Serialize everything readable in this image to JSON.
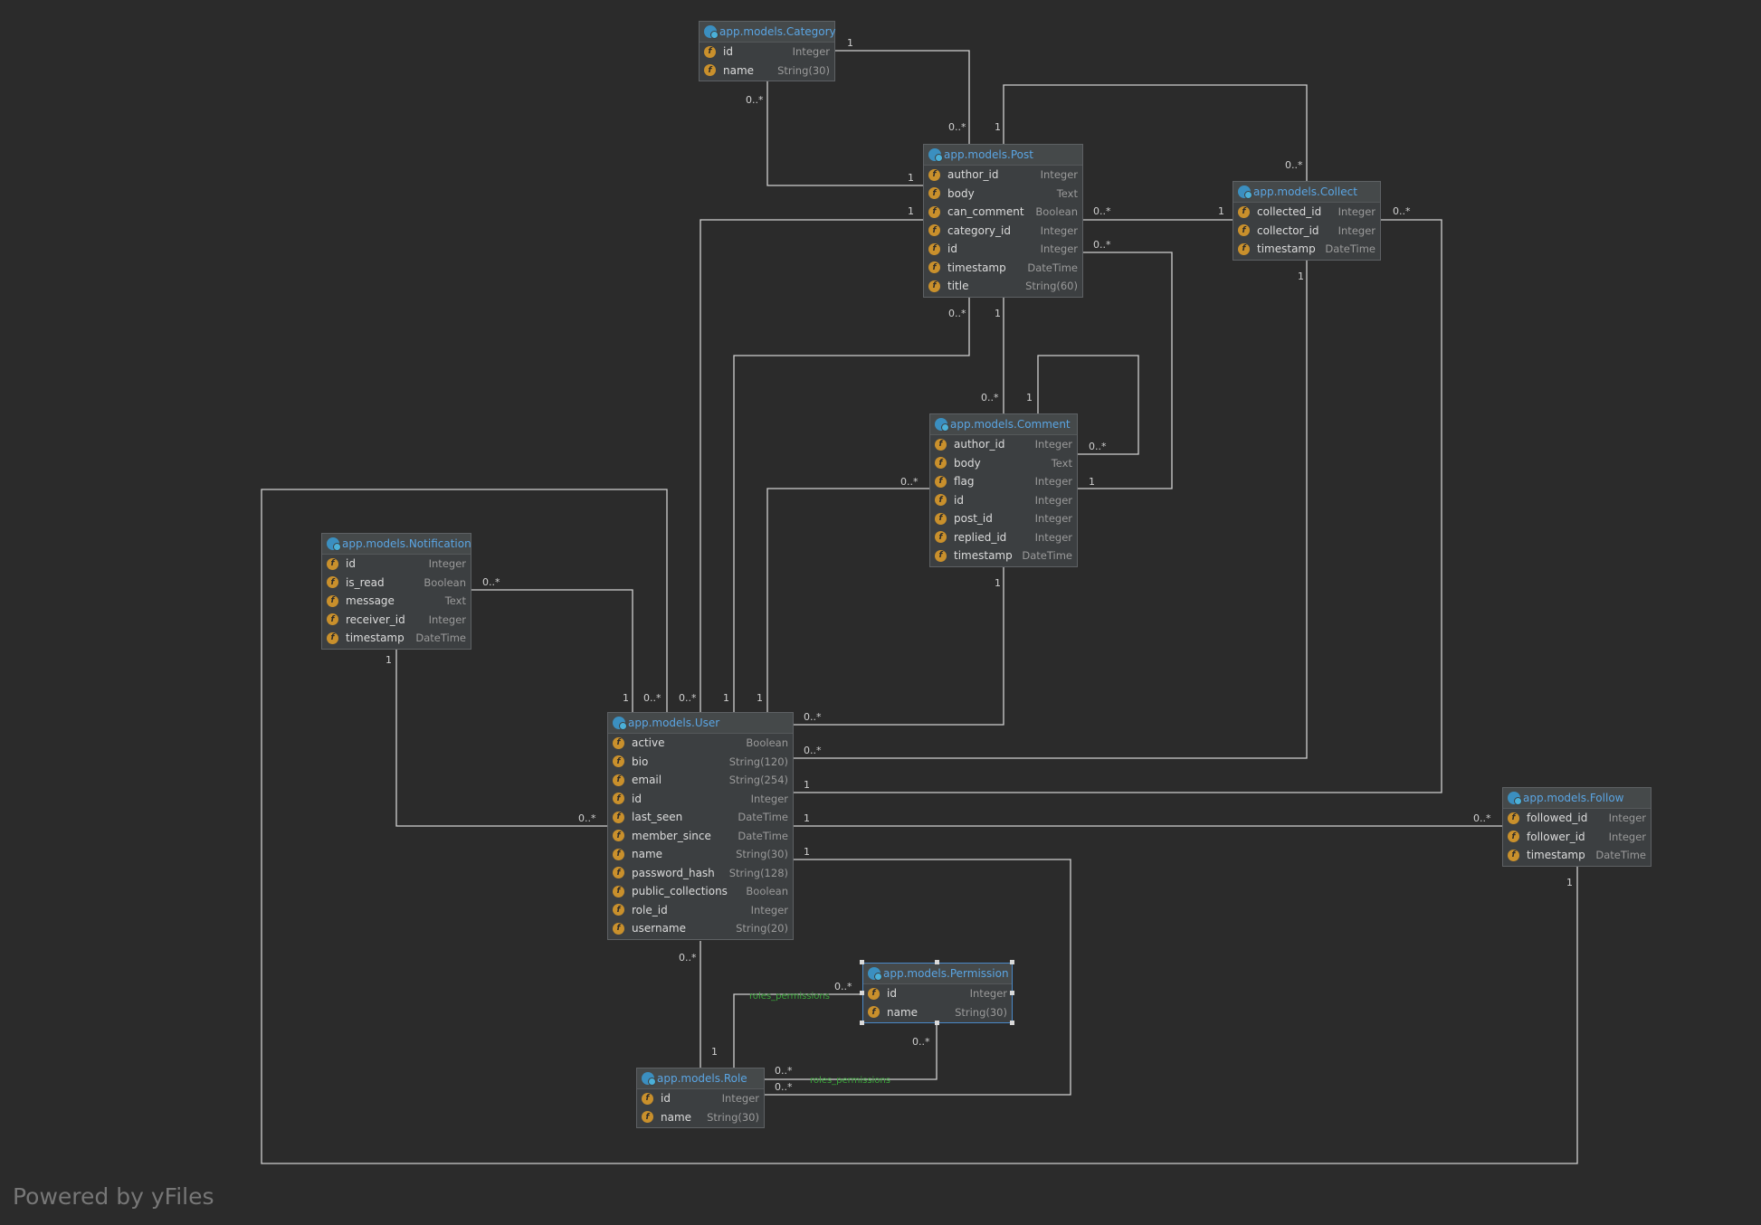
{
  "entities": [
    {
      "key": "category",
      "name": "app.models.Category",
      "fields": [
        {
          "name": "id",
          "type": "Integer"
        },
        {
          "name": "name",
          "type": "String(30)"
        }
      ]
    },
    {
      "key": "post",
      "name": "app.models.Post",
      "fields": [
        {
          "name": "author_id",
          "type": "Integer"
        },
        {
          "name": "body",
          "type": "Text"
        },
        {
          "name": "can_comment",
          "type": "Boolean"
        },
        {
          "name": "category_id",
          "type": "Integer"
        },
        {
          "name": "id",
          "type": "Integer"
        },
        {
          "name": "timestamp",
          "type": "DateTime"
        },
        {
          "name": "title",
          "type": "String(60)"
        }
      ]
    },
    {
      "key": "collect",
      "name": "app.models.Collect",
      "fields": [
        {
          "name": "collected_id",
          "type": "Integer"
        },
        {
          "name": "collector_id",
          "type": "Integer"
        },
        {
          "name": "timestamp",
          "type": "DateTime"
        }
      ]
    },
    {
      "key": "comment",
      "name": "app.models.Comment",
      "fields": [
        {
          "name": "author_id",
          "type": "Integer"
        },
        {
          "name": "body",
          "type": "Text"
        },
        {
          "name": "flag",
          "type": "Integer"
        },
        {
          "name": "id",
          "type": "Integer"
        },
        {
          "name": "post_id",
          "type": "Integer"
        },
        {
          "name": "replied_id",
          "type": "Integer"
        },
        {
          "name": "timestamp",
          "type": "DateTime"
        }
      ]
    },
    {
      "key": "notification",
      "name": "app.models.Notification",
      "fields": [
        {
          "name": "id",
          "type": "Integer"
        },
        {
          "name": "is_read",
          "type": "Boolean"
        },
        {
          "name": "message",
          "type": "Text"
        },
        {
          "name": "receiver_id",
          "type": "Integer"
        },
        {
          "name": "timestamp",
          "type": "DateTime"
        }
      ]
    },
    {
      "key": "user",
      "name": "app.models.User",
      "fields": [
        {
          "name": "active",
          "type": "Boolean"
        },
        {
          "name": "bio",
          "type": "String(120)"
        },
        {
          "name": "email",
          "type": "String(254)"
        },
        {
          "name": "id",
          "type": "Integer"
        },
        {
          "name": "last_seen",
          "type": "DateTime"
        },
        {
          "name": "member_since",
          "type": "DateTime"
        },
        {
          "name": "name",
          "type": "String(30)"
        },
        {
          "name": "password_hash",
          "type": "String(128)"
        },
        {
          "name": "public_collections",
          "type": "Boolean"
        },
        {
          "name": "role_id",
          "type": "Integer"
        },
        {
          "name": "username",
          "type": "String(20)"
        }
      ]
    },
    {
      "key": "follow",
      "name": "app.models.Follow",
      "fields": [
        {
          "name": "followed_id",
          "type": "Integer"
        },
        {
          "name": "follower_id",
          "type": "Integer"
        },
        {
          "name": "timestamp",
          "type": "DateTime"
        }
      ]
    },
    {
      "key": "permission",
      "name": "app.models.Permission",
      "fields": [
        {
          "name": "id",
          "type": "Integer"
        },
        {
          "name": "name",
          "type": "String(30)"
        }
      ]
    },
    {
      "key": "role",
      "name": "app.models.Role",
      "fields": [
        {
          "name": "id",
          "type": "Integer"
        },
        {
          "name": "name",
          "type": "String(30)"
        }
      ]
    }
  ],
  "multiplicities": [
    "1",
    "0..*"
  ],
  "association_label": "roles_permissions",
  "watermark": "Powered by yFiles",
  "colors": {
    "background": "#2b2b2b",
    "box": "#3c3f41",
    "entity_name": "#5aa5e3",
    "field_icon": "#c9902c",
    "association": "#3aa53a"
  }
}
